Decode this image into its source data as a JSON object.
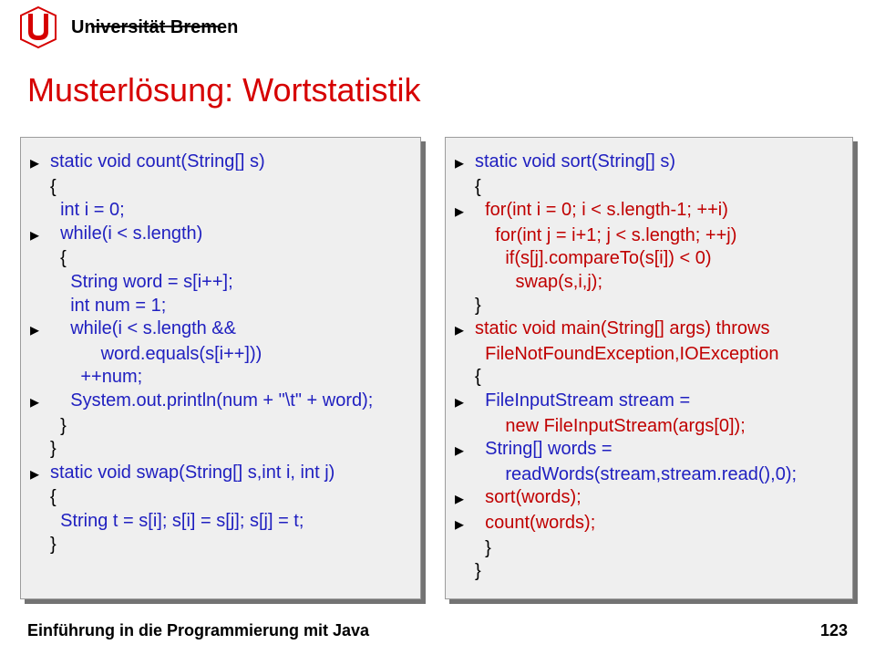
{
  "header": {
    "university": "Universität Bremen"
  },
  "title": "Musterlösung: Wortstatistik",
  "code_left": [
    {
      "b": true,
      "ind": 0,
      "t": "static void count(String[] s)",
      "c": "blue"
    },
    {
      "b": false,
      "ind": 0,
      "t": "{",
      "c": "black"
    },
    {
      "b": false,
      "ind": 1,
      "t": "int i = 0;",
      "c": "blue"
    },
    {
      "b": true,
      "ind": 1,
      "t": "while(i < s.length)",
      "c": "blue"
    },
    {
      "b": false,
      "ind": 1,
      "t": "{",
      "c": "black"
    },
    {
      "b": false,
      "ind": 2,
      "t": "String word = s[i++];",
      "c": "blue"
    },
    {
      "b": false,
      "ind": 2,
      "t": "int num = 1;",
      "c": "blue"
    },
    {
      "b": true,
      "ind": 2,
      "t": "while(i < s.length &&",
      "c": "blue"
    },
    {
      "b": false,
      "ind": 5,
      "t": "word.equals(s[i++]))",
      "c": "blue"
    },
    {
      "b": false,
      "ind": 3,
      "t": "++num;",
      "c": "blue"
    },
    {
      "b": true,
      "ind": 2,
      "t": "System.out.println(num + \"\\t\" + word);",
      "c": "blue"
    },
    {
      "b": false,
      "ind": 1,
      "t": "}",
      "c": "black"
    },
    {
      "b": false,
      "ind": 0,
      "t": "}",
      "c": "black"
    },
    {
      "b": true,
      "ind": 0,
      "t": "static void swap(String[] s,int i, int j)",
      "c": "blue"
    },
    {
      "b": false,
      "ind": 0,
      "t": "{",
      "c": "black"
    },
    {
      "b": false,
      "ind": 1,
      "t": "String t = s[i]; s[i] = s[j]; s[j] = t;",
      "c": "blue"
    },
    {
      "b": false,
      "ind": 0,
      "t": "}",
      "c": "black"
    }
  ],
  "code_right": [
    {
      "b": true,
      "ind": 0,
      "t": "static void sort(String[] s)",
      "c": "blue"
    },
    {
      "b": false,
      "ind": 0,
      "t": "{",
      "c": "black"
    },
    {
      "b": true,
      "ind": 1,
      "t": "for(int i = 0; i < s.length-1; ++i)",
      "c": "red"
    },
    {
      "b": false,
      "ind": 2,
      "t": "for(int j = i+1; j < s.length; ++j)",
      "c": "red"
    },
    {
      "b": false,
      "ind": 3,
      "t": "if(s[j].compareTo(s[i]) < 0)",
      "c": "red"
    },
    {
      "b": false,
      "ind": 4,
      "t": "swap(s,i,j);",
      "c": "red"
    },
    {
      "b": false,
      "ind": 0,
      "t": "}",
      "c": "black"
    },
    {
      "b": true,
      "ind": 0,
      "t": "static void main(String[] args) throws",
      "c": "red"
    },
    {
      "b": false,
      "ind": 1,
      "t": "FileNotFoundException,IOException",
      "c": "red"
    },
    {
      "b": false,
      "ind": 0,
      "t": "{",
      "c": "black"
    },
    {
      "b": true,
      "ind": 1,
      "t": "FileInputStream stream =",
      "c": "blue"
    },
    {
      "b": false,
      "ind": 3,
      "t": "new FileInputStream(args[0]);",
      "c": "red"
    },
    {
      "b": true,
      "ind": 1,
      "t": "String[] words =",
      "c": "blue"
    },
    {
      "b": false,
      "ind": 3,
      "t": "readWords(stream,stream.read(),0);",
      "c": "blue"
    },
    {
      "b": true,
      "ind": 1,
      "t": "sort(words);",
      "c": "red"
    },
    {
      "b": true,
      "ind": 1,
      "t": "count(words);",
      "c": "red"
    },
    {
      "b": false,
      "ind": 1,
      "t": "}",
      "c": "black"
    },
    {
      "b": false,
      "ind": 0,
      "t": "}",
      "c": "black"
    }
  ],
  "footer": {
    "text": "Einführung in die Programmierung mit Java",
    "page": "123"
  }
}
